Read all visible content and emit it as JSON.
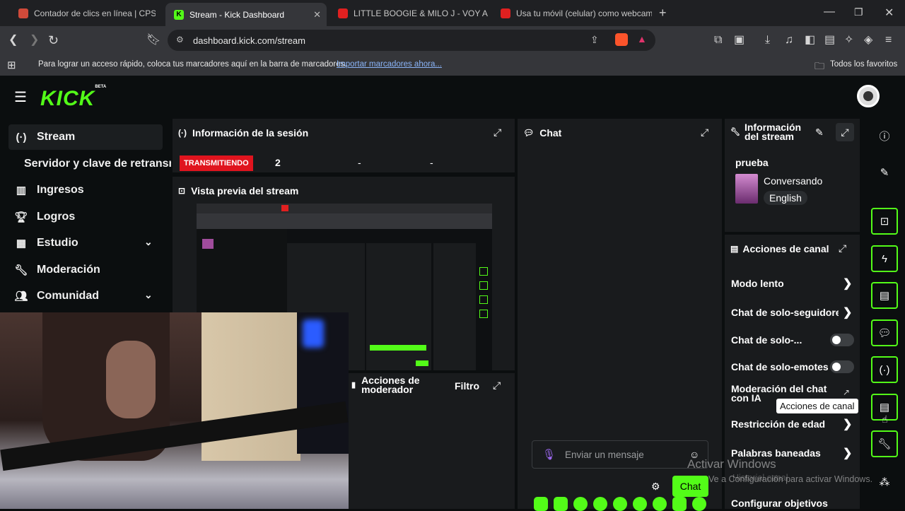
{
  "browser": {
    "tabs": [
      {
        "title": "Contador de clics en línea | CPS Chec",
        "fav_color": "#d04a3a",
        "active": false
      },
      {
        "title": "Stream - Kick Dashboard",
        "fav_color": "#53fc18",
        "active": true
      },
      {
        "title": "LITTLE BOOGIE & MILO J - VOY A DIS",
        "fav_color": "#e02020",
        "active": false
      },
      {
        "title": "Usa tu móvil (celular) como webcam",
        "fav_color": "#e02020",
        "active": false
      }
    ],
    "url": "dashboard.kick.com/stream",
    "bookmarks_text": "Para lograr un acceso rápido, coloca tus marcadores aquí en la barra de marcadores.",
    "bookmarks_link": "Importar marcadores ahora...",
    "all_bookmarks": "Todos los favoritos"
  },
  "app": {
    "logo": "KICK",
    "logo_badge": "BETA",
    "sidebar": {
      "items": [
        {
          "label": "Stream",
          "icon": "broadcast-icon"
        },
        {
          "label": "Servidor y clave de retransmisión"
        },
        {
          "label": "Ingresos",
          "icon": "bar-chart-icon"
        },
        {
          "label": "Logros",
          "icon": "trophy-icon"
        },
        {
          "label": "Estudio",
          "icon": "studio-icon"
        },
        {
          "label": "Moderación",
          "icon": "wrench-icon"
        },
        {
          "label": "Comunidad",
          "icon": "users-icon"
        }
      ]
    },
    "session": {
      "title": "Información de la sesión",
      "status": "TRANSMITIENDO",
      "viewers": "2",
      "stat2": "-",
      "stat3": "-"
    },
    "preview": {
      "title": "Vista previa del stream"
    },
    "moderator": {
      "title": "Acciones de moderador",
      "filter": "Filtro"
    },
    "chat": {
      "title": "Chat",
      "placeholder": "Enviar un mensaje",
      "send": "Chat"
    },
    "stream_info": {
      "title": "Información del stream",
      "stream_title": "prueba",
      "category": "Conversando",
      "language": "English"
    },
    "channel_actions": {
      "title": "Acciones de canal",
      "rows": [
        {
          "label": "Modo lento",
          "control": "chevron"
        },
        {
          "label": "Chat de solo-seguidores",
          "control": "chevron"
        },
        {
          "label": "Chat de solo-...",
          "control": "toggle"
        },
        {
          "label": "Chat de solo-emotes",
          "control": "toggle"
        },
        {
          "label": "Moderación del chat con IA",
          "control": "link"
        },
        {
          "label": "Restricción de edad",
          "control": "chevron"
        },
        {
          "label": "Palabras baneadas",
          "control": "chevron"
        },
        {
          "label": "Configurar objetivos",
          "control": "chevron"
        }
      ]
    },
    "tooltip": "Acciones de canal",
    "watermark": {
      "line1": "Activar Windows",
      "line2": "Ve a Configuración para activar Windows.",
      "overlay": "Historial canal"
    }
  },
  "colors": {
    "accent": "#53fc18",
    "live": "#e0141e"
  }
}
